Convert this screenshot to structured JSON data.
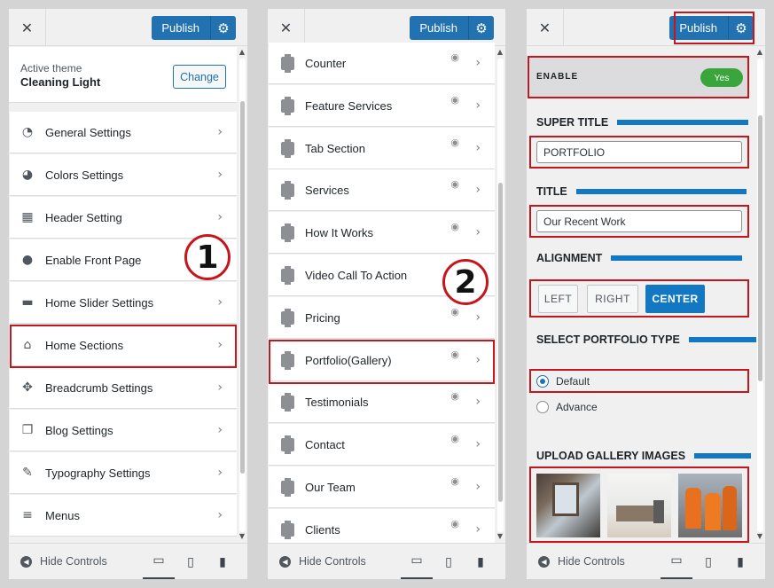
{
  "publish_label": "Publish",
  "hide_controls": "Hide Controls",
  "panel1": {
    "active_theme_label": "Active theme",
    "theme_name": "Cleaning Light",
    "change_label": "Change",
    "items": [
      {
        "label": "General Settings"
      },
      {
        "label": "Colors Settings"
      },
      {
        "label": "Header Setting"
      },
      {
        "label": "Enable Front Page"
      },
      {
        "label": "Home Slider Settings"
      },
      {
        "label": "Home Sections"
      },
      {
        "label": "Breadcrumb Settings"
      },
      {
        "label": "Blog Settings"
      },
      {
        "label": "Typography Settings"
      },
      {
        "label": "Menus"
      }
    ],
    "step_badge": "1"
  },
  "panel2": {
    "items": [
      {
        "label": "Counter"
      },
      {
        "label": "Feature Services"
      },
      {
        "label": "Tab Section"
      },
      {
        "label": "Services"
      },
      {
        "label": "How It Works"
      },
      {
        "label": "Video Call To Action"
      },
      {
        "label": "Pricing"
      },
      {
        "label": "Portfolio(Gallery)"
      },
      {
        "label": "Testimonials"
      },
      {
        "label": "Contact"
      },
      {
        "label": "Our Team"
      },
      {
        "label": "Clients"
      }
    ],
    "step_badge": "2"
  },
  "panel3": {
    "enable_label": "ENABLE",
    "enable_toggle": "Yes",
    "super_title_label": "SUPER TITLE",
    "super_title_value": "PORTFOLIO",
    "title_label": "TITLE",
    "title_value": "Our Recent Work",
    "alignment_label": "ALIGNMENT",
    "align_left": "LEFT",
    "align_right": "RIGHT",
    "align_center": "CENTER",
    "select_type_label": "SELECT PORTFOLIO TYPE",
    "type_default": "Default",
    "type_advance": "Advance",
    "upload_label": "UPLOAD GALLERY IMAGES"
  },
  "colors": {
    "accent": "#2271b1",
    "highlight": "#c4161c",
    "toggle": "#3aa53a",
    "section_bar": "#1278c4"
  }
}
